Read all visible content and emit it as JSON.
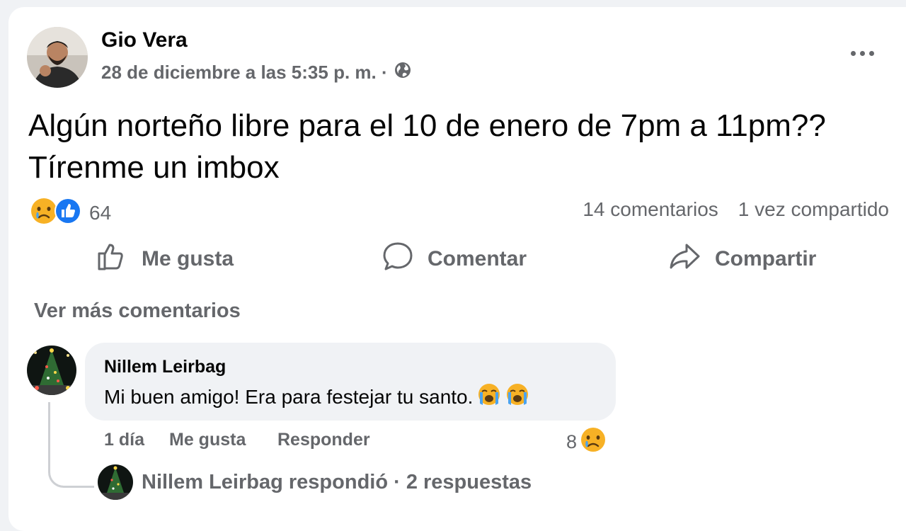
{
  "post": {
    "author": "Gio Vera",
    "time": "28 de diciembre a las 5:35 p. m. ·",
    "text": "Algún norteño libre para el 10 de enero de 7pm a 11pm?? Tírenme un imbox",
    "reaction_count": "64",
    "comments_count": "14 comentarios",
    "shares_count": "1 vez compartido",
    "reaction_icons": [
      "sad-face-icon",
      "like-icon"
    ]
  },
  "actions": {
    "like": "Me gusta",
    "comment": "Comentar",
    "share": "Compartir"
  },
  "comments": {
    "see_more": "Ver más comentarios",
    "items": [
      {
        "author": "Nillem Leirbag",
        "text": "Mi buen amigo! Era para festejar tu santo.",
        "emoji": [
          "loudly-crying-face-icon",
          "loudly-crying-face-icon"
        ],
        "age": "1 día",
        "like": "Me gusta",
        "reply": "Responder",
        "reaction_count": "8",
        "replies_summary": "Nillem Leirbag respondió · 2 respuestas"
      }
    ]
  },
  "colors": {
    "background": "#f0f2f5",
    "card": "#ffffff",
    "primary_text": "#050505",
    "secondary_text": "#65676b",
    "like_blue": "#1877f2",
    "emoji_yellow": "#f7b125"
  }
}
